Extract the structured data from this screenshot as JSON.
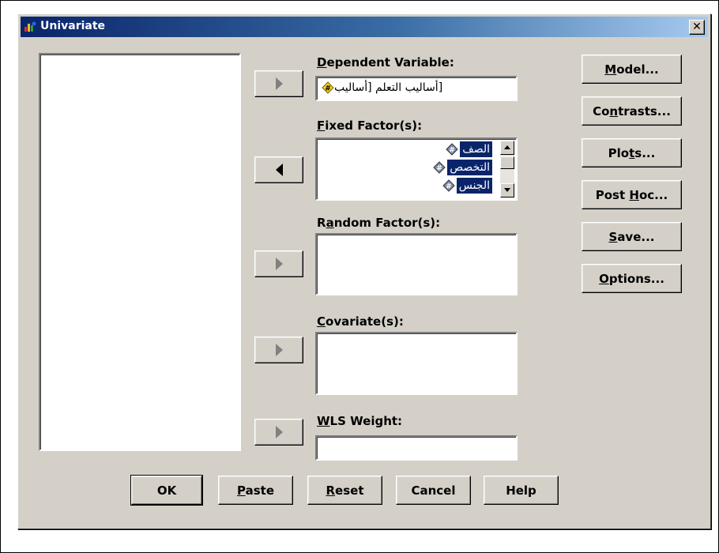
{
  "window": {
    "title": "Univariate",
    "close_symbol": "✕"
  },
  "source_list": {
    "items": []
  },
  "dependent_variable": {
    "label_mnemonic": "D",
    "label_rest": "ependent Variable:",
    "value": "[أساليب التعلم [أساليب"
  },
  "fixed_factors": {
    "label_mnemonic": "F",
    "label_rest": "ixed Factor(s):",
    "items": [
      "الصف",
      "التخصص",
      "الجنس"
    ]
  },
  "random_factors": {
    "label_pre": "R",
    "label_mnemonic": "a",
    "label_rest": "ndom Factor(s):"
  },
  "covariates": {
    "label_mnemonic": "C",
    "label_rest": "ovariate(s):"
  },
  "wls_weight": {
    "label_mnemonic": "W",
    "label_rest": "LS Weight:"
  },
  "side_buttons": {
    "model": {
      "mn": "M",
      "rest": "odel..."
    },
    "contrasts": {
      "pre": "Co",
      "mn": "n",
      "rest": "trasts..."
    },
    "plots": {
      "pre": "Plo",
      "mn": "t",
      "rest": "s..."
    },
    "post_hoc": {
      "pre": "Post ",
      "mn": "H",
      "rest": "oc..."
    },
    "save": {
      "mn": "S",
      "rest": "ave..."
    },
    "options": {
      "mn": "O",
      "rest": "ptions..."
    }
  },
  "bottom_buttons": {
    "ok": "OK",
    "paste": {
      "mn": "P",
      "rest": "aste"
    },
    "reset": {
      "mn": "R",
      "rest": "eset"
    },
    "cancel": "Cancel",
    "help": "Help"
  },
  "colors": {
    "dialog_face": "#d4d0c8",
    "titlebar_start": "#0a246a",
    "titlebar_end": "#a6caf0",
    "selection": "#0a246a"
  },
  "icons": {
    "app": "spss-app-icon",
    "variable": "scale-variable-icon"
  }
}
